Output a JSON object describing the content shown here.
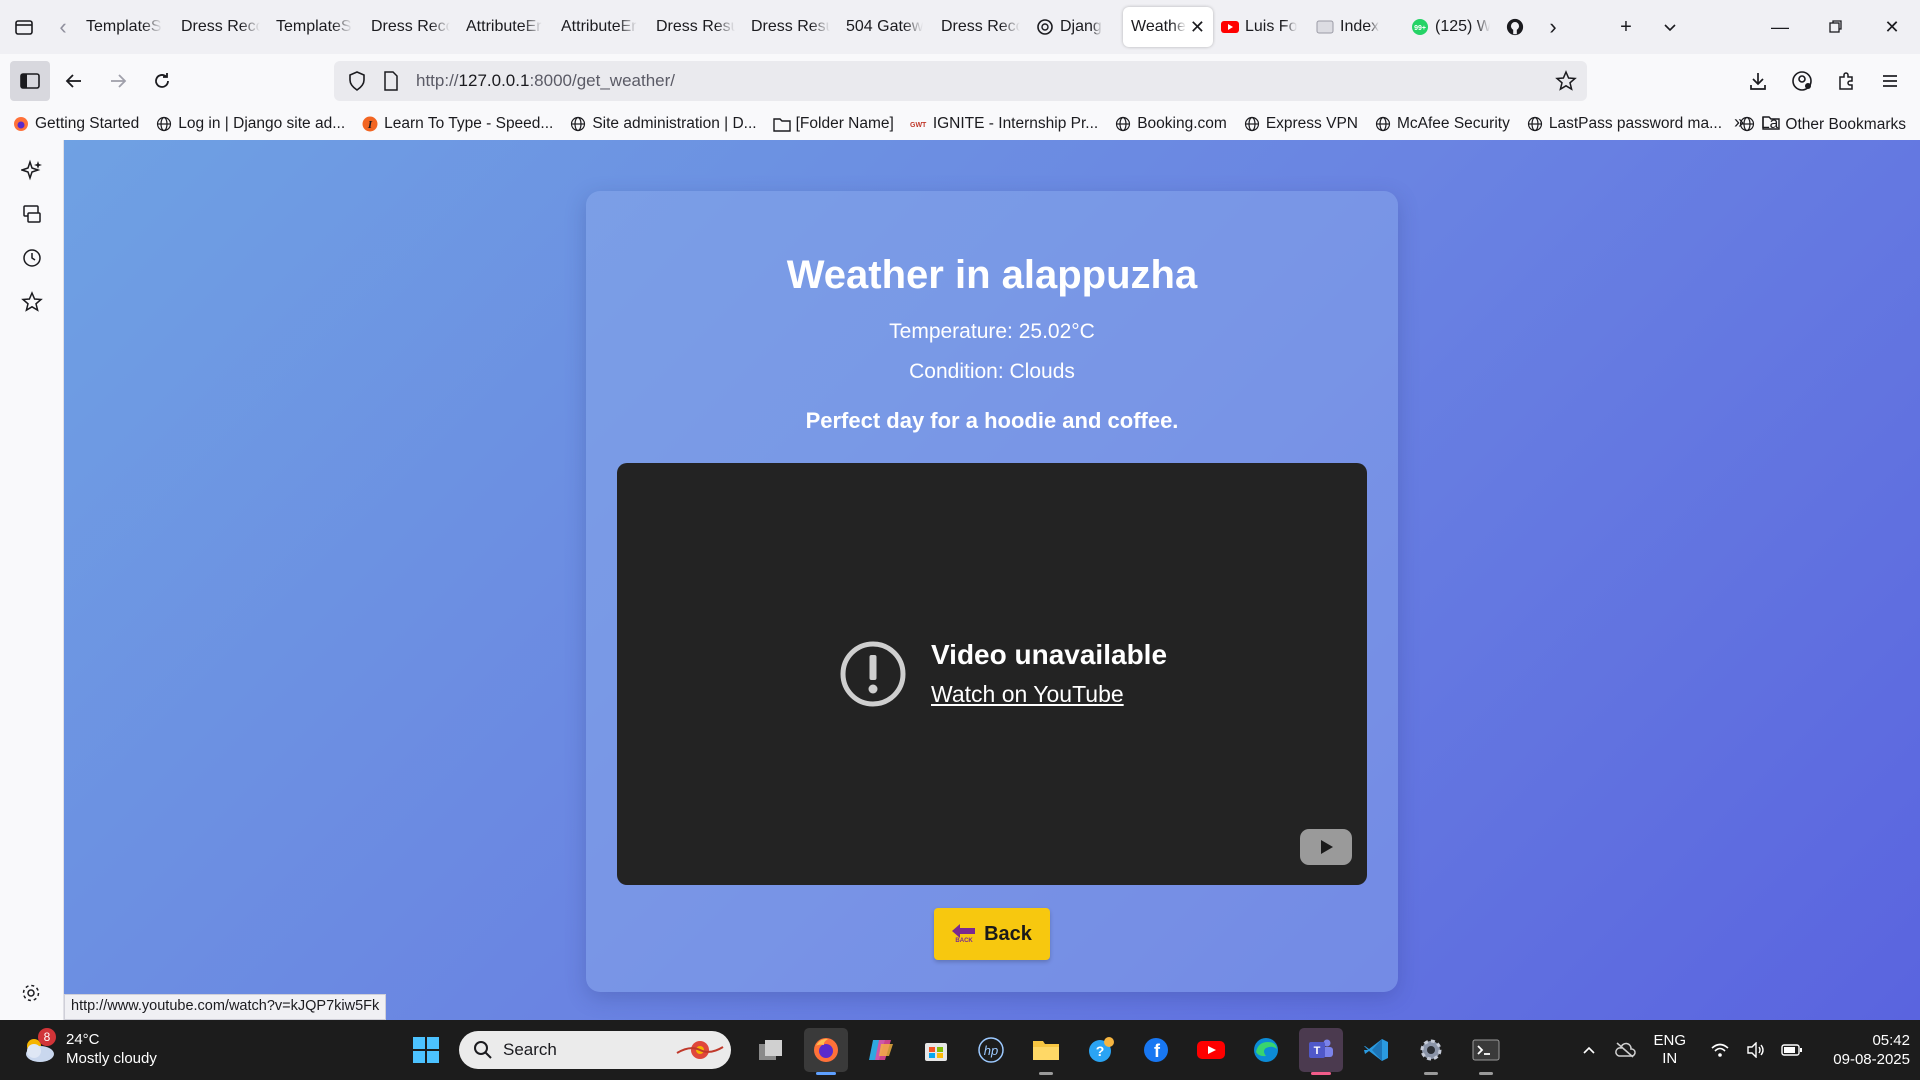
{
  "browser": {
    "tabs": [
      {
        "label": "TemplateS",
        "icon": "none"
      },
      {
        "label": "Dress Recc",
        "icon": "none"
      },
      {
        "label": "TemplateS",
        "icon": "none"
      },
      {
        "label": "Dress Recc",
        "icon": "none"
      },
      {
        "label": "AttributeEr",
        "icon": "none"
      },
      {
        "label": "AttributeEr",
        "icon": "none"
      },
      {
        "label": "Dress Resu",
        "icon": "none"
      },
      {
        "label": "Dress Resu",
        "icon": "none"
      },
      {
        "label": "504 Gatew",
        "icon": "none"
      },
      {
        "label": "Dress Recc",
        "icon": "none"
      },
      {
        "label": "Djang",
        "icon": "openai-icon"
      },
      {
        "label": "Weathe",
        "icon": "none",
        "active": true
      },
      {
        "label": "Luis Fo",
        "icon": "youtube-icon"
      },
      {
        "label": "Index",
        "icon": "drive-icon"
      },
      {
        "label": "(125) W",
        "icon": "whatsapp-icon",
        "badge": "99+"
      },
      {
        "label": "",
        "icon": "github-icon"
      }
    ],
    "url": {
      "prefix": "http://",
      "host": "127.0.0.1",
      "rest": ":8000/get_weather/"
    },
    "bookmarks": [
      {
        "label": "Getting Started",
        "icon": "firefox-icon"
      },
      {
        "label": "Log in | Django site ad...",
        "icon": "globe-icon"
      },
      {
        "label": "Learn To Type - Speed...",
        "icon": "typing-icon"
      },
      {
        "label": "Site administration | D...",
        "icon": "globe-icon"
      },
      {
        "label": "[Folder Name]",
        "icon": "folder-icon"
      },
      {
        "label": "IGNITE - Internship Pr...",
        "icon": "ignite-icon"
      },
      {
        "label": "Booking.com",
        "icon": "globe-icon"
      },
      {
        "label": "Express VPN",
        "icon": "globe-icon"
      },
      {
        "label": "McAfee Security",
        "icon": "globe-icon"
      },
      {
        "label": "LastPass password ma...",
        "icon": "globe-icon"
      },
      {
        "label": "La",
        "icon": "globe-icon"
      }
    ],
    "other_bookmarks": "Other Bookmarks",
    "status_link": "http://www.youtube.com/watch?v=kJQP7kiw5Fk"
  },
  "page": {
    "title": "Weather in alappuzha",
    "temperature": "Temperature: 25.02°C",
    "condition": "Condition: Clouds",
    "tip": "Perfect day for a hoodie and coffee.",
    "video": {
      "error_title": "Video unavailable",
      "watch_link": "Watch on YouTube"
    },
    "back_button": "Back",
    "back_icon_caption": "BACK"
  },
  "taskbar": {
    "weather": {
      "temp": "24°C",
      "desc": "Mostly cloudy",
      "badge": "8"
    },
    "search_placeholder": "Search",
    "lang": {
      "line1": "ENG",
      "line2": "IN"
    },
    "clock": {
      "time": "05:42",
      "date": "09-08-2025"
    }
  },
  "colors": {
    "accent_button": "#f7c80f",
    "page_gradient_start": "#6fa1e3",
    "page_gradient_end": "#5a64df",
    "video_bg": "#232323",
    "taskbar_bg": "#1c1c1c"
  }
}
